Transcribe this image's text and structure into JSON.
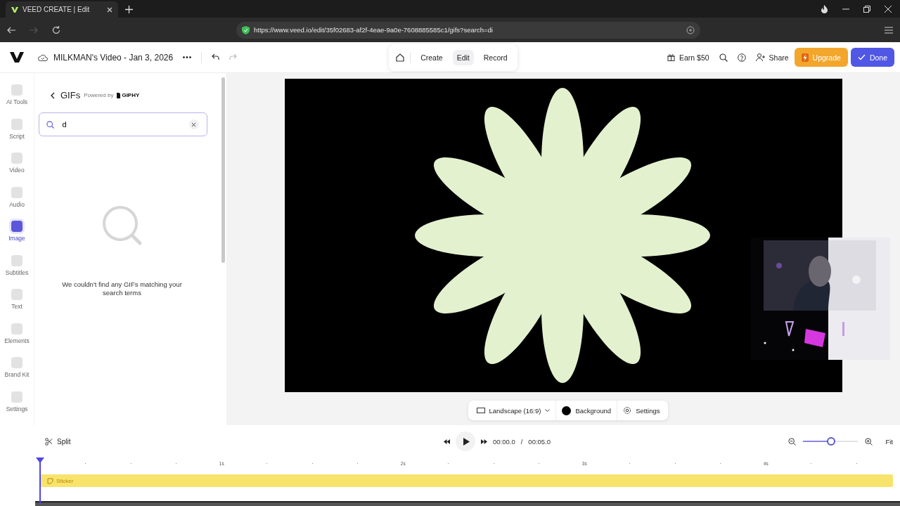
{
  "browser": {
    "tab_title": "VEED CREATE | Edit",
    "url": "https://www.veed.io/edit/35f02683-af2f-4eae-9a0e-7608885585c1/gifs?search=di"
  },
  "topbar": {
    "project_title": "MILKMAN's Video - Jan 3, 2026",
    "modes": [
      {
        "label": "Create",
        "selected": false
      },
      {
        "label": "Edit",
        "selected": true
      },
      {
        "label": "Record",
        "selected": false
      }
    ],
    "earn": "Earn $50",
    "share": "Share",
    "upgrade": "Upgrade",
    "done": "Done"
  },
  "sidebar": {
    "items": [
      {
        "label": "AI Tools",
        "selected": false
      },
      {
        "label": "Script",
        "selected": false
      },
      {
        "label": "Video",
        "selected": false
      },
      {
        "label": "Audio",
        "selected": false
      },
      {
        "label": "Image",
        "selected": true
      },
      {
        "label": "Subtitles",
        "selected": false
      },
      {
        "label": "Text",
        "selected": false
      },
      {
        "label": "Elements",
        "selected": false
      },
      {
        "label": "Brand Kit",
        "selected": false
      },
      {
        "label": "Settings",
        "selected": false
      }
    ]
  },
  "panel": {
    "title": "GIFs",
    "powered_by": "Powered by",
    "brand": "GIPHY",
    "search": {
      "value": "d"
    },
    "empty_message": "We couldn't find any GIFs matching your search terms"
  },
  "canvas_toolbar": {
    "aspect": "Landscape (16:9)",
    "background": "Background",
    "settings": "Settings"
  },
  "timeline": {
    "split": "Split",
    "current_time": "00:00.0",
    "separator": "/",
    "duration": "00:05.0",
    "zoom": {
      "level": 0.5
    },
    "fit": "Fit",
    "ruler": [
      "1s",
      "2s",
      "3s",
      "4s"
    ],
    "clips": [
      {
        "label": "Sticker"
      }
    ]
  }
}
